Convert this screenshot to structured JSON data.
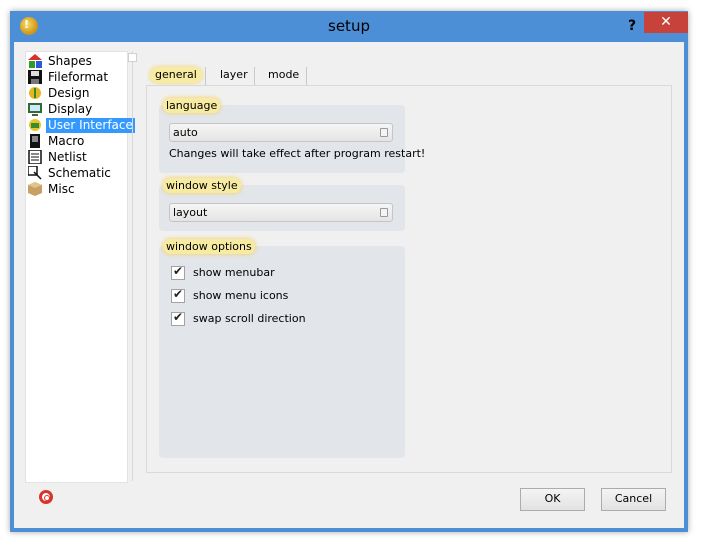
{
  "window": {
    "title": "setup",
    "help_glyph": "?",
    "close_glyph": "✕",
    "accent": "#4d8fd6",
    "close_color": "#c7423a"
  },
  "tree": {
    "items": [
      {
        "label": "Shapes",
        "icon": "shapes-icon",
        "selected": false
      },
      {
        "label": "Fileformat",
        "icon": "floppy-disk-icon",
        "selected": false
      },
      {
        "label": "Design",
        "icon": "design-icon",
        "selected": false
      },
      {
        "label": "Display",
        "icon": "display-icon",
        "selected": false
      },
      {
        "label": "User Interface",
        "icon": "user-interface-icon",
        "selected": true
      },
      {
        "label": "Macro",
        "icon": "macro-icon",
        "selected": false
      },
      {
        "label": "Netlist",
        "icon": "netlist-icon",
        "selected": false
      },
      {
        "label": "Schematic",
        "icon": "schematic-icon",
        "selected": false
      },
      {
        "label": "Misc",
        "icon": "package-icon",
        "selected": false
      }
    ],
    "selected_color": "#3399ff"
  },
  "tabs": [
    {
      "label": "general",
      "active": true
    },
    {
      "label": "layer",
      "active": false
    },
    {
      "label": "mode",
      "active": false
    }
  ],
  "general": {
    "language": {
      "title": "language",
      "value": "auto",
      "note": "Changes will take effect after program restart!"
    },
    "window_style": {
      "title": "window style",
      "value": "layout"
    },
    "window_options": {
      "title": "window options",
      "options": [
        {
          "label": "show menubar",
          "checked": true
        },
        {
          "label": "show menu icons",
          "checked": true
        },
        {
          "label": "swap scroll direction",
          "checked": true
        }
      ]
    },
    "highlight_color": "#f7eaa3"
  },
  "footer": {
    "ok_label": "OK",
    "cancel_label": "Cancel",
    "help_icon": "lifebuoy-icon"
  }
}
